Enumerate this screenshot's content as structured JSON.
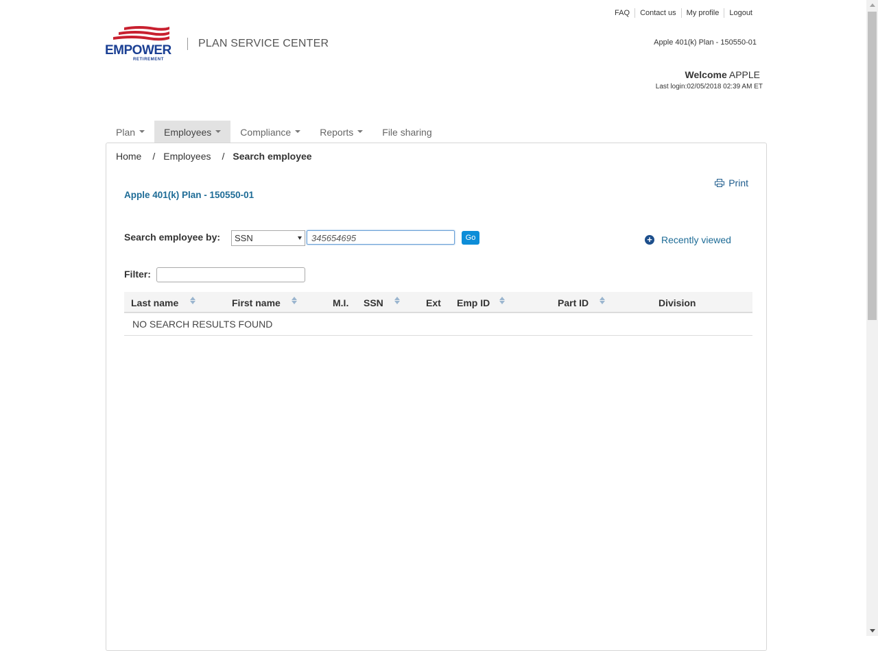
{
  "top_links": [
    "FAQ",
    "Contact us",
    "My profile",
    "Logout"
  ],
  "brand": {
    "logo_word": "EMPOWER",
    "logo_sub": "RETIREMENT",
    "site_title": "PLAN SERVICE CENTER",
    "logo_color": "#1a3f93",
    "flag_color": "#c8202f"
  },
  "header": {
    "plan_name": "Apple 401(k) Plan - 150550-01",
    "welcome_prefix": "Welcome",
    "welcome_user": "APPLE",
    "last_login": "Last login:02/05/2018 02:39 AM ET"
  },
  "nav": [
    {
      "label": "Plan",
      "dropdown": true,
      "active": false
    },
    {
      "label": "Employees",
      "dropdown": true,
      "active": true
    },
    {
      "label": "Compliance",
      "dropdown": true,
      "active": false
    },
    {
      "label": "Reports",
      "dropdown": true,
      "active": false
    },
    {
      "label": "File sharing",
      "dropdown": false,
      "active": false
    }
  ],
  "breadcrumb": {
    "home": "Home",
    "section": "Employees",
    "current": "Search employee",
    "separator": "/"
  },
  "print_label": "Print",
  "plan_title": "Apple 401(k) Plan - 150550-01",
  "search": {
    "label": "Search employee by:",
    "selected_option": "SSN",
    "value": "345654695",
    "go_label": "Go"
  },
  "recently_viewed": "Recently viewed",
  "filter_label": "Filter:",
  "table": {
    "columns": [
      "Last name",
      "First name",
      "M.I.",
      "SSN",
      "Ext",
      "Emp ID",
      "Part ID",
      "Division"
    ],
    "empty_message": "NO SEARCH RESULTS FOUND"
  },
  "colors": {
    "accent_blue": "#1d6b96",
    "go_button": "#0d8dd8",
    "nav_active_bg": "#e2e2e2"
  }
}
